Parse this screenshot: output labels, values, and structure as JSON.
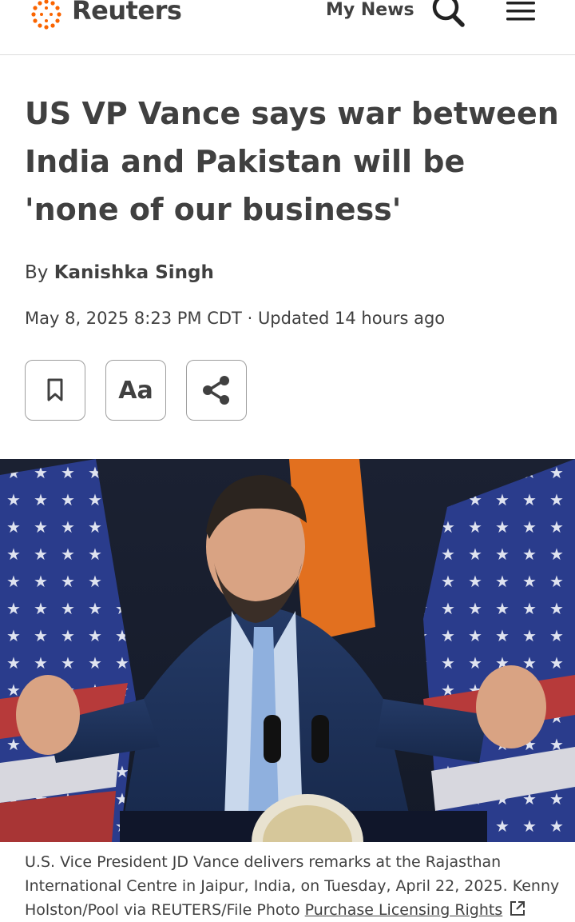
{
  "header": {
    "brand": "Reuters",
    "my_news": "My News",
    "icons": {
      "logo": "reuters-dots-logo",
      "search": "search-icon",
      "menu": "hamburger-menu-icon"
    }
  },
  "article": {
    "headline": "US VP Vance says war between India and Pakistan will be 'none of our business'",
    "byline_prefix": "By",
    "author": "Kanishka Singh",
    "date": "May 8, 2025 8:23 PM CDT",
    "separator": "·",
    "updated": "Updated 14 hours ago"
  },
  "toolbar": {
    "bookmark_icon": "bookmark-icon",
    "text_size_label": "Aa",
    "share_icon": "share-icon"
  },
  "photo": {
    "caption": "U.S. Vice President JD Vance delivers remarks at the Rajasthan International Centre in Jaipur, India, on Tuesday, April 22, 2025. Kenny Holston/Pool via REUTERS/File Photo",
    "rights_link": "Purchase Licensing Rights",
    "external_icon": "external-link-icon"
  },
  "colors": {
    "text": "#404040",
    "accent": "#fa6400",
    "border": "#9e9e9e"
  }
}
